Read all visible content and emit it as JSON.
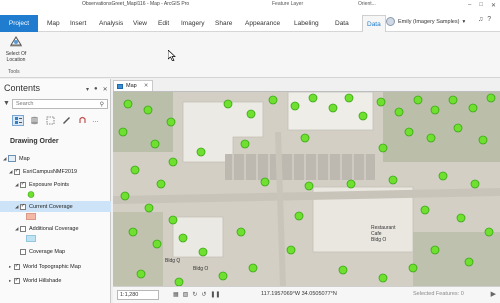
{
  "window": {
    "title": "ObservationsGreet_Mapl116 - Map - ArcGIS Pro",
    "feature_layer_label": "Feature Layer",
    "orient_label": "Orient..."
  },
  "ribbon": {
    "tabs": [
      "Project",
      "Map",
      "Insert",
      "Analysis",
      "View",
      "Edit",
      "Imagery",
      "Share",
      "Appearance",
      "Labeling",
      "Data"
    ],
    "active_tab": "Data",
    "user": "Emily (Imagery Samples)",
    "tool": {
      "label": "Select Of Location",
      "group": "Tools",
      "icon": "select-by-location-icon"
    }
  },
  "contents": {
    "title": "Contents",
    "search_placeholder": "Search",
    "drawing_order_label": "Drawing Order",
    "tree": {
      "map": "Map",
      "group_layer": "EsriCampusNMF2019",
      "exposure_points": "Exposure Points",
      "current_coverage": "Current Coverage",
      "additional_coverage": "Additional Coverage",
      "coverage_map": "Coverage Map",
      "world_topographic": "World Topographic Map",
      "world_hillshade": "World Hillshade"
    },
    "swatch_colors": {
      "current": "#f4b9a6",
      "additional": "#bfe3f3"
    }
  },
  "map": {
    "tab_label": "Map",
    "labels": {
      "bldg_q": "Bldg Q",
      "bldg_o": "Bldg O",
      "restaurant": "Restaurant\nCafe\nBldg O"
    }
  },
  "status": {
    "scale": "1:1,280",
    "coordinates": "117.1957069°W 34.0505077°N",
    "selected": "Selected Features: 0"
  },
  "colors": {
    "accent": "#1f7ccf",
    "point_fill": "#6fe02f",
    "point_stroke": "#3aa815"
  }
}
